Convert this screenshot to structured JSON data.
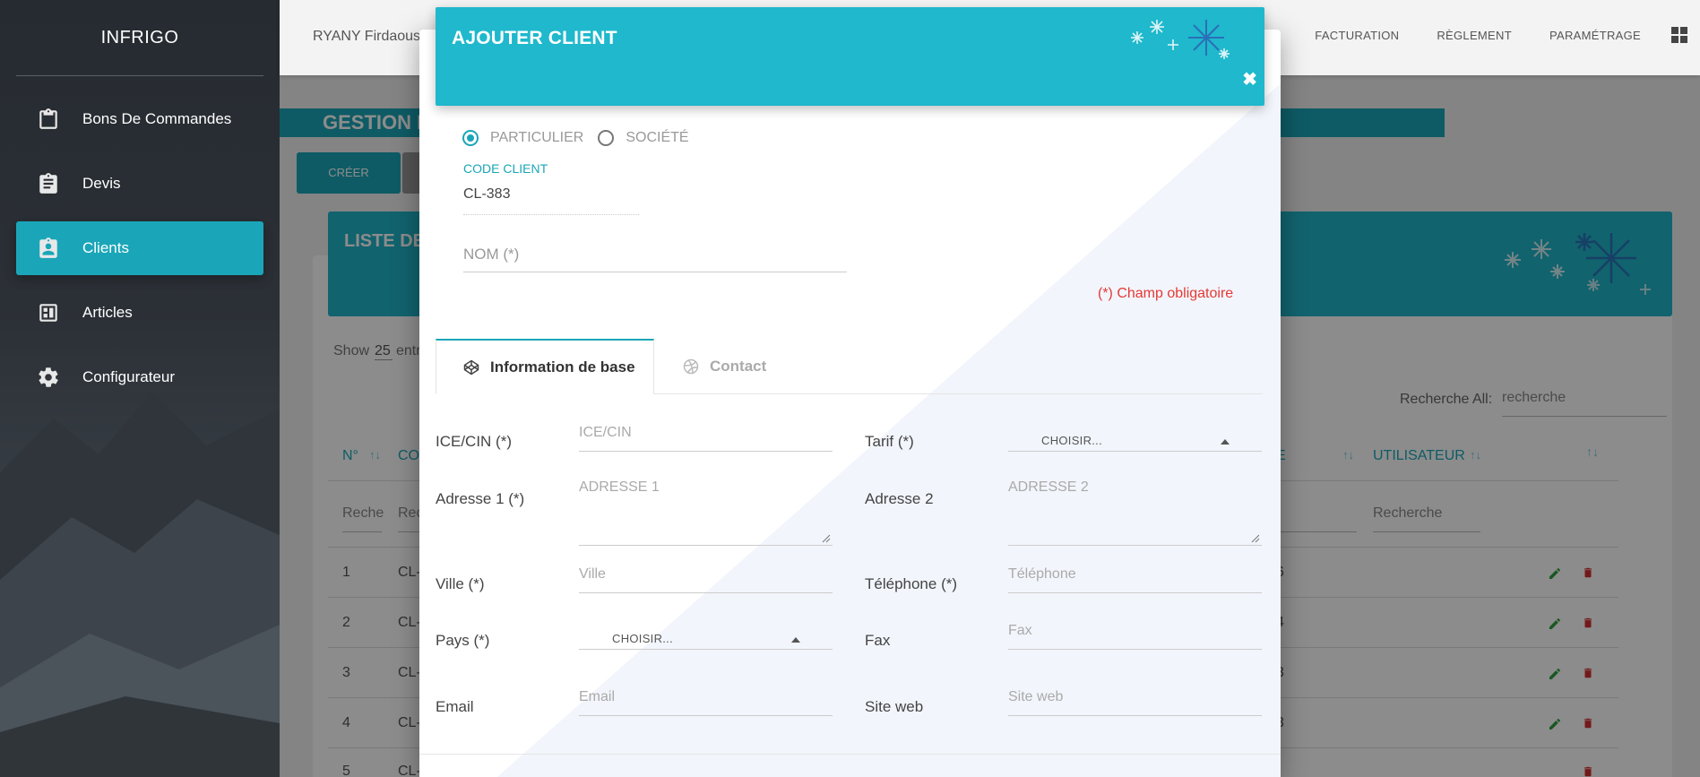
{
  "app": {
    "brand": "INFRIGO"
  },
  "sidebar": {
    "items": [
      {
        "label": "Bons De Commandes",
        "icon": "clipboard-icon",
        "active": false
      },
      {
        "label": "Devis",
        "icon": "clipboard-list-icon",
        "active": false
      },
      {
        "label": "Clients",
        "icon": "contact-card-icon",
        "active": true
      },
      {
        "label": "Articles",
        "icon": "article-icon",
        "active": false
      },
      {
        "label": "Configurateur",
        "icon": "gear-icon",
        "active": false
      }
    ]
  },
  "topbar": {
    "user": "RYANY Firdaous",
    "nav": [
      "FACTURATION",
      "RÈGLEMENT",
      "PARAMÉTRAGE"
    ]
  },
  "page": {
    "section_title": "GESTION I",
    "create_button": "CRÉER",
    "list_title": "LISTE DE",
    "show_label": "Show",
    "show_value": "25",
    "show_suffix": "entr",
    "search_all_label": "Recherche All:",
    "search_all_placeholder": "recherche",
    "columns": [
      "N°",
      "CO",
      "E",
      "UTILISATEUR"
    ],
    "col_search": [
      "Reche",
      "Rec",
      "Recherche"
    ],
    "rows": [
      {
        "n": "1",
        "code": "CL-",
        "e": "6"
      },
      {
        "n": "2",
        "code": "CL-",
        "e": "4"
      },
      {
        "n": "3",
        "code": "CL-",
        "e": "3"
      },
      {
        "n": "4",
        "code": "CL-",
        "e": "3"
      },
      {
        "n": "5",
        "code": "CL-",
        "e": ""
      }
    ]
  },
  "modal": {
    "title": "AJOUTER CLIENT",
    "close": "✖",
    "radio_particulier": "PARTICULIER",
    "radio_societe": "SOCIÉTÉ",
    "code_label": "CODE CLIENT",
    "code_value": "CL-383",
    "nom_placeholder": "NOM (*)",
    "required_note": "(*) Champ obligatoire",
    "tabs": [
      "Information de base",
      "Contact"
    ],
    "fields": {
      "ice_label": "ICE/CIN (*)",
      "ice_placeholder": "ICE/CIN",
      "tarif_label": "Tarif (*)",
      "tarif_value": "CHOISIR...",
      "adresse1_label": "Adresse 1 (*)",
      "adresse1_placeholder": "ADRESSE 1",
      "adresse2_label": "Adresse 2",
      "adresse2_placeholder": "ADRESSE 2",
      "ville_label": "Ville (*)",
      "ville_placeholder": "Ville",
      "telephone_label": "Téléphone (*)",
      "telephone_placeholder": "Téléphone",
      "pays_label": "Pays (*)",
      "pays_value": "CHOISIR...",
      "fax_label": "Fax",
      "fax_placeholder": "Fax",
      "email_label": "Email",
      "email_placeholder": "Email",
      "siteweb_label": "Site web",
      "siteweb_placeholder": "Site web"
    }
  },
  "colors": {
    "accent": "#1aa6b8",
    "header": "#1fb8cc",
    "required": "#e53935",
    "edit": "#2e9e3e",
    "delete": "#d32f2f"
  }
}
